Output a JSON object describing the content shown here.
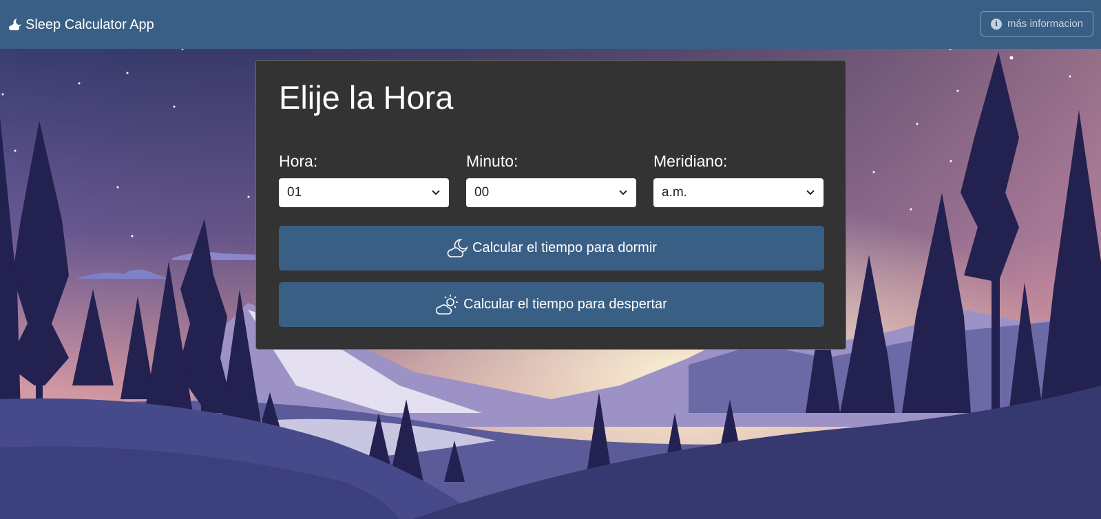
{
  "navbar": {
    "brand_icon": "cloud-moon-icon",
    "brand": "Sleep Calculator App",
    "info_icon": "info-circle-icon",
    "info_label": "más informacion",
    "background": "#3a5f85"
  },
  "card": {
    "title": "Elije la Hora",
    "fields": [
      {
        "label": "Hora:",
        "value": "01"
      },
      {
        "label": "Minuto:",
        "value": "00"
      },
      {
        "label": "Meridiano:",
        "value": "a.m."
      }
    ],
    "buttons": [
      {
        "icon": "cloud-moon-icon",
        "label": "Calcular el tiempo para dormir"
      },
      {
        "icon": "cloud-sun-icon",
        "label": "Calcular el tiempo para despertar"
      }
    ]
  },
  "colors": {
    "primary": "#3a5f85",
    "card_bg": "#333333"
  }
}
